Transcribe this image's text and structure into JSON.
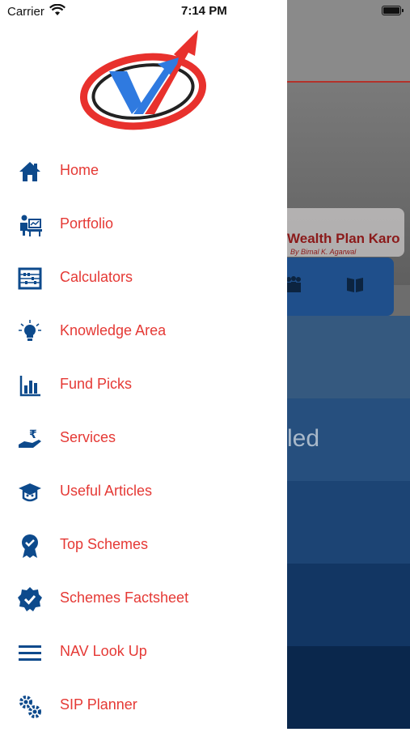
{
  "status_bar": {
    "carrier": "Carrier",
    "time": "7:14 PM"
  },
  "background": {
    "brand": "Wealth Plan Karo",
    "tagline": "By Bimal K. Agarwal",
    "partial_text": "led"
  },
  "colors": {
    "menu_text": "#e53935",
    "icon": "#0d4a8c"
  },
  "menu": {
    "items": [
      {
        "label": "Home",
        "icon": "home-icon"
      },
      {
        "label": "Portfolio",
        "icon": "portfolio-icon"
      },
      {
        "label": "Calculators",
        "icon": "abacus-icon"
      },
      {
        "label": "Knowledge Area",
        "icon": "lightbulb-icon"
      },
      {
        "label": "Fund Picks",
        "icon": "bar-chart-icon"
      },
      {
        "label": "Services",
        "icon": "rupee-hand-icon"
      },
      {
        "label": "Useful Articles",
        "icon": "graduation-cap-icon"
      },
      {
        "label": "Top Schemes",
        "icon": "badge-ribbon-icon"
      },
      {
        "label": "Schemes Factsheet",
        "icon": "verified-badge-icon"
      },
      {
        "label": "NAV Look Up",
        "icon": "menu-lines-icon"
      },
      {
        "label": "SIP Planner",
        "icon": "gears-icon"
      }
    ]
  }
}
